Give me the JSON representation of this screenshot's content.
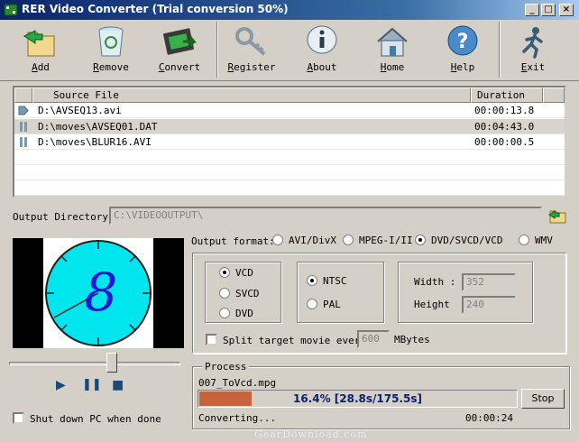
{
  "window": {
    "title": "RER Video Converter (Trial conversion 50%)",
    "controls": {
      "minimize": "_",
      "maximize": "□",
      "close": "×"
    }
  },
  "toolbar": {
    "add": "Add",
    "remove": "Remove",
    "convert": "Convert",
    "register": "Register",
    "about": "About",
    "home": "Home",
    "help": "Help",
    "exit": "Exit"
  },
  "file_list": {
    "columns": {
      "source": "Source File",
      "duration": "Duration"
    },
    "rows": [
      {
        "source": "D:\\AVSEQ13.avi",
        "duration": "00:00:13.8",
        "icon": "play-state-icon"
      },
      {
        "source": "D:\\moves\\AVSEQ01.DAT",
        "duration": "00:04:43.0",
        "icon": "pause-state-icon"
      },
      {
        "source": "D:\\moves\\BLUR16.AVI",
        "duration": "00:00:00.5",
        "icon": "pause-state-icon"
      }
    ]
  },
  "output_directory": {
    "label": "Output Directory:",
    "value": "C:\\VIDEOOUTPUT\\"
  },
  "output_format": {
    "label": "Output format:",
    "options": [
      "AVI/DivX",
      "MPEG-I/II",
      "DVD/SVCD/VCD",
      "WMV"
    ],
    "selected": "DVD/SVCD/VCD"
  },
  "disc_type": {
    "options": [
      "VCD",
      "SVCD",
      "DVD"
    ],
    "selected": "VCD"
  },
  "tv_system": {
    "options": [
      "NTSC",
      "PAL"
    ],
    "selected": "NTSC"
  },
  "dimensions": {
    "width_label": "Width :",
    "width_value": "352",
    "height_label": "Height",
    "height_value": "240"
  },
  "split": {
    "label": "Split target movie every",
    "value": "600",
    "unit": "MBytes",
    "checked": false
  },
  "preview": {
    "digit": "8"
  },
  "player": {
    "play": "▶",
    "pause": "⏸",
    "stop": "■"
  },
  "shutdown": {
    "label": "Shut down PC when done",
    "checked": false
  },
  "process": {
    "title": "Process",
    "filename": "007_ToVcd.mpg",
    "progress_text": "16.4%  [28.8s/175.5s]",
    "progress_fraction": 0.164,
    "stop_label": "Stop",
    "status": "Converting...",
    "elapsed": "00:00:24"
  },
  "watermark": "GearDownload.com",
  "colors": {
    "titlebar": "#0a246a",
    "progress_fill": "#c8643c",
    "clock_face": "#00e5ee"
  }
}
